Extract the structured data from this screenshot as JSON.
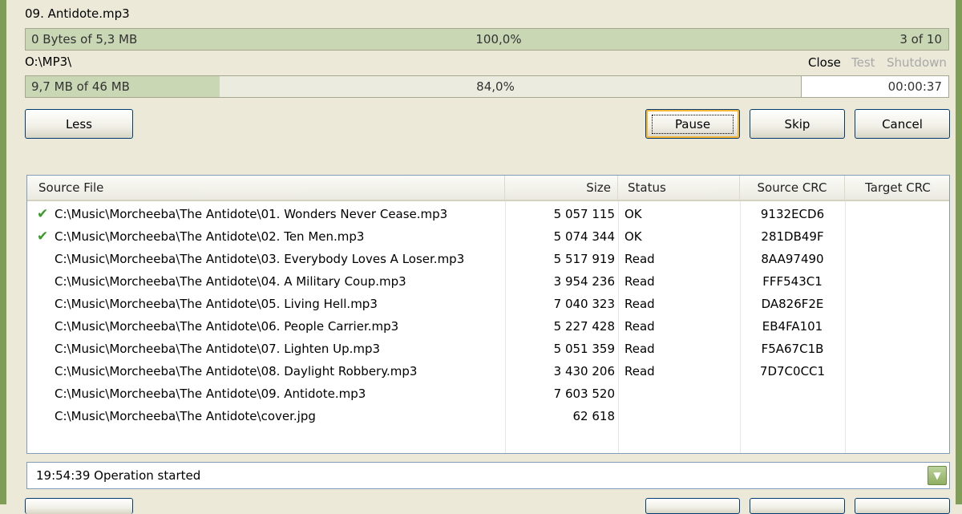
{
  "file": {
    "name": "09. Antidote.mp3",
    "progress_text": "0 Bytes of 5,3 MB",
    "percent_text": "100,0%",
    "percent": 100.0,
    "count_text": "3 of 10"
  },
  "total": {
    "path": "O:\\MP3\\",
    "progress_text": "9,7 MB of 46 MB",
    "percent_text": "84,0%",
    "percent": 21,
    "time": "00:00:37"
  },
  "after_actions": {
    "close": "Close",
    "test": "Test",
    "shutdown": "Shutdown"
  },
  "buttons": {
    "less": "Less",
    "pause": "Pause",
    "skip": "Skip",
    "cancel": "Cancel"
  },
  "table": {
    "columns": {
      "source_file": "Source File",
      "size": "Size",
      "status": "Status",
      "source_crc": "Source CRC",
      "target_crc": "Target CRC"
    },
    "rows": [
      {
        "done": true,
        "file": "C:\\Music\\Morcheeba\\The Antidote\\01. Wonders Never Cease.mp3",
        "size": "5 057 115",
        "status": "OK",
        "source_crc": "9132ECD6",
        "target_crc": ""
      },
      {
        "done": true,
        "file": "C:\\Music\\Morcheeba\\The Antidote\\02. Ten Men.mp3",
        "size": "5 074 344",
        "status": "OK",
        "source_crc": "281DB49F",
        "target_crc": ""
      },
      {
        "done": false,
        "file": "C:\\Music\\Morcheeba\\The Antidote\\03. Everybody Loves A Loser.mp3",
        "size": "5 517 919",
        "status": "Read",
        "source_crc": "8AA97490",
        "target_crc": ""
      },
      {
        "done": false,
        "file": "C:\\Music\\Morcheeba\\The Antidote\\04. A Military Coup.mp3",
        "size": "3 954 236",
        "status": "Read",
        "source_crc": "FFF543C1",
        "target_crc": ""
      },
      {
        "done": false,
        "file": "C:\\Music\\Morcheeba\\The Antidote\\05. Living Hell.mp3",
        "size": "7 040 323",
        "status": "Read",
        "source_crc": "DA826F2E",
        "target_crc": ""
      },
      {
        "done": false,
        "file": "C:\\Music\\Morcheeba\\The Antidote\\06. People Carrier.mp3",
        "size": "5 227 428",
        "status": "Read",
        "source_crc": "EB4FA101",
        "target_crc": ""
      },
      {
        "done": false,
        "file": "C:\\Music\\Morcheeba\\The Antidote\\07. Lighten Up.mp3",
        "size": "5 051 359",
        "status": "Read",
        "source_crc": "F5A67C1B",
        "target_crc": ""
      },
      {
        "done": false,
        "file": "C:\\Music\\Morcheeba\\The Antidote\\08. Daylight Robbery.mp3",
        "size": "3 430 206",
        "status": "Read",
        "source_crc": "7D7C0CC1",
        "target_crc": ""
      },
      {
        "done": false,
        "file": "C:\\Music\\Morcheeba\\The Antidote\\09. Antidote.mp3",
        "size": "7 603 520",
        "status": "",
        "source_crc": "",
        "target_crc": ""
      },
      {
        "done": false,
        "file": "C:\\Music\\Morcheeba\\The Antidote\\cover.jpg",
        "size": "62 618",
        "status": "",
        "source_crc": "",
        "target_crc": ""
      }
    ]
  },
  "log": {
    "message": "19:54:39 Operation started",
    "dropdown_icon": "chevron-down-icon"
  },
  "colors": {
    "progress_fill": "#c9d7b4",
    "window_border": "#7f9d57",
    "check": "#3a9a2a"
  }
}
